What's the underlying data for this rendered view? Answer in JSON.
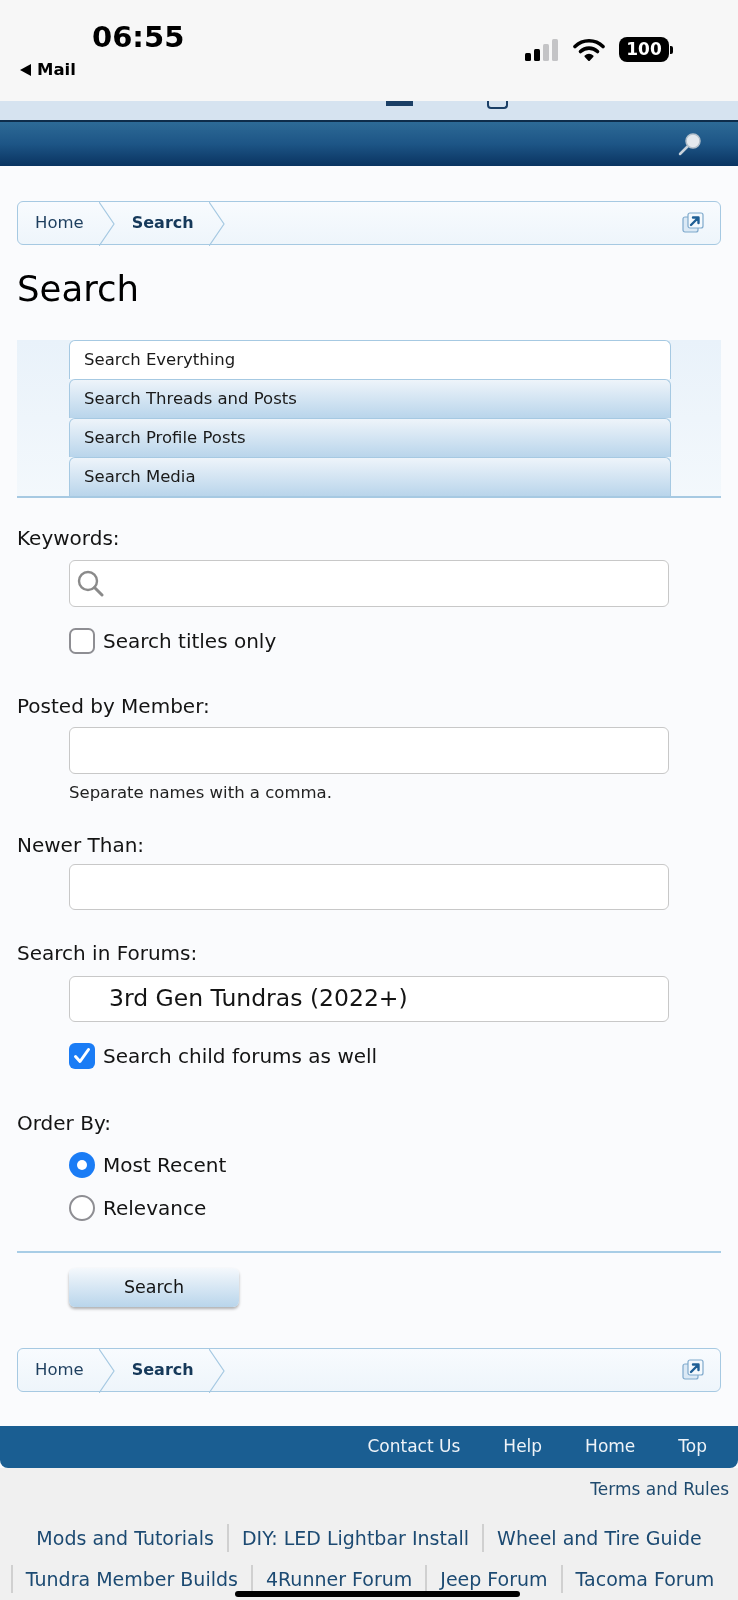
{
  "status_bar": {
    "time": "06:55",
    "back": "Mail",
    "battery": "100"
  },
  "breadcrumb": [
    {
      "label": "Home",
      "current": false
    },
    {
      "label": "Search",
      "current": true
    }
  ],
  "title": "Search",
  "tabs": [
    {
      "label": "Search Everything",
      "selected": true
    },
    {
      "label": "Search Threads and Posts",
      "selected": false
    },
    {
      "label": "Search Profile Posts",
      "selected": false
    },
    {
      "label": "Search Media",
      "selected": false
    }
  ],
  "form": {
    "keywords": {
      "label": "Keywords:"
    },
    "titles_only": {
      "label": "Search titles only",
      "checked": false
    },
    "posted_by": {
      "label": "Posted by Member:",
      "note": "Separate names with a comma."
    },
    "newer_than": {
      "label": "Newer Than:"
    },
    "forums": {
      "label": "Search in Forums:",
      "value": "3rd Gen Tundras (2022+)"
    },
    "child_forums": {
      "label": "Search child forums as well",
      "checked": true
    },
    "order_by": {
      "label": "Order By:",
      "options": [
        {
          "label": "Most Recent",
          "selected": true
        },
        {
          "label": "Relevance",
          "selected": false
        }
      ]
    },
    "submit": "Search"
  },
  "breadcrumb_bottom": [
    {
      "label": "Home",
      "current": false
    },
    {
      "label": "Search",
      "current": true
    }
  ],
  "footer_nav": [
    "Contact Us",
    "Help",
    "Home",
    "Top"
  ],
  "terms_link": "Terms and Rules",
  "related_links": [
    [
      "Mods and Tutorials",
      "DIY: LED Lightbar Install",
      "Wheel and Tire Guide"
    ],
    [
      "Tundra Member Builds",
      "4Runner Forum",
      "Jeep Forum",
      "Tacoma Forum"
    ]
  ]
}
